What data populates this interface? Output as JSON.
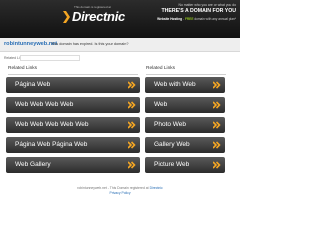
{
  "header": {
    "logo_tagline": "This domain is registered at",
    "logo_text": "Directnic",
    "promo_line1": "No matter who you are or what you do",
    "promo_line2": "THERE'S A DOMAIN FOR YOU",
    "promo_host_label": "Website Hosting",
    "promo_host_free": "FREE",
    "promo_host_rest": "domain with any annual plan*"
  },
  "domainbar": {
    "domain": "robintunneyweb.net",
    "message": "This domain has expired. Is this your domain?"
  },
  "search": {
    "label": "Related Links"
  },
  "columns": {
    "left_title": "Related Links",
    "right_title": "Related Links"
  },
  "left_links": [
    "Página Web",
    "Web Web Web Web",
    "Web Web Web Web Web",
    "Página Web Página Web",
    "Web Gallery"
  ],
  "right_links": [
    "Web with Web",
    "Web",
    "Photo Web",
    "Gallery Web",
    "Picture Web"
  ],
  "footer": {
    "line1_pre": "robintunneyweb.net - This Domain registered at",
    "line1_link": "Directnic",
    "line2_link": "Privacy Policy"
  },
  "colors": {
    "accent": "#f5a623",
    "link": "#2a6fb5",
    "button_dark": "#2c2c2c"
  },
  "icons": {
    "arrow": "double-chevron-right-icon"
  }
}
